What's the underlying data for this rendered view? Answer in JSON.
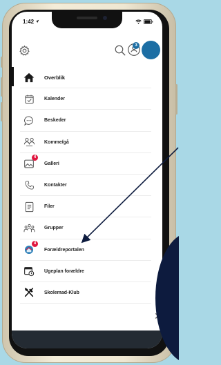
{
  "status": {
    "time": "1:42",
    "time_icon": "location-arrow-icon"
  },
  "header": {
    "settings_icon": "gear-icon",
    "search_icon": "search-icon",
    "notification_count": "3"
  },
  "menu": {
    "items": [
      {
        "label": "Overblik",
        "icon": "home-icon",
        "active": true
      },
      {
        "label": "Kalender",
        "icon": "calendar-icon"
      },
      {
        "label": "Beskeder",
        "icon": "chat-bubble-icon"
      },
      {
        "label": "Komme/gå",
        "icon": "people-icon"
      },
      {
        "label": "Galleri",
        "icon": "gallery-icon",
        "badge": "4"
      },
      {
        "label": "Kontakter",
        "icon": "phone-icon"
      },
      {
        "label": "Filer",
        "icon": "file-icon"
      },
      {
        "label": "Grupper",
        "icon": "group-icon"
      },
      {
        "label": "Forældreportalen",
        "icon": "parent-portal-icon",
        "badge": "4"
      },
      {
        "label": "Ugeplan forældre",
        "icon": "calendar-clock-icon"
      },
      {
        "label": "Skolemad-Klub",
        "icon": "cutlery-icon"
      }
    ]
  },
  "colors": {
    "background": "#a9d8e6",
    "accent": "#1c6ea4",
    "badge": "#e0163f",
    "annotation_circle": "#0d1b3e",
    "bottom_bar": "#242b33"
  },
  "close_icon": "close-icon"
}
